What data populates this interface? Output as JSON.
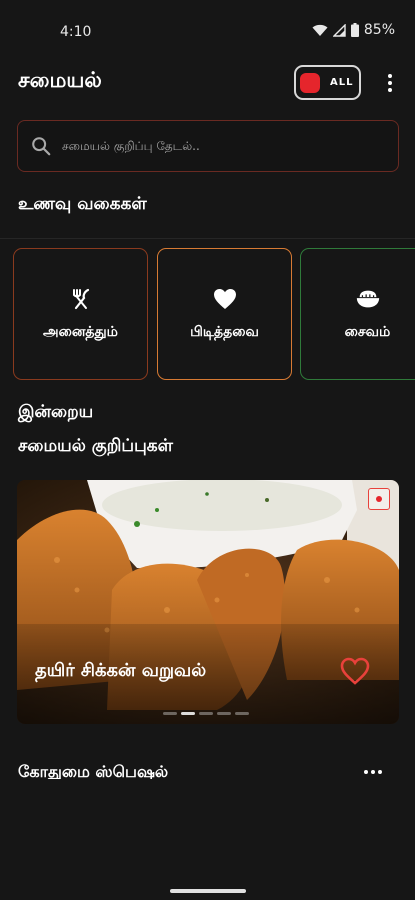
{
  "status_bar": {
    "time": "4:10",
    "battery": "85%"
  },
  "header": {
    "title": "சமையல்",
    "toggle_label": "ALL"
  },
  "search": {
    "placeholder": "சமையல் குறிப்பு தேடல்.."
  },
  "categories": {
    "title": "உணவு வகைகள்",
    "items": [
      {
        "label": "அனைத்தும்",
        "icon": "fork-knife-icon",
        "border_color": "#8a3a1e"
      },
      {
        "label": "பிடித்தவை",
        "icon": "heart-icon",
        "border_color": "#d77a33"
      },
      {
        "label": "சைவம்",
        "icon": "bowl-icon",
        "border_color": "#2f7a3a"
      }
    ]
  },
  "today": {
    "title_line1": "இன்றைய",
    "title_line2": "சமையல் குறிப்புகள்",
    "featured": {
      "title": "தயிர் சிக்கன் வறுவல்",
      "slides": 5,
      "active_slide": 2
    }
  },
  "next_section": {
    "title": "கோதுமை ஸ்பெஷல்"
  },
  "colors": {
    "accent": "#e5252c",
    "background": "#161616",
    "heart": "#e8413b"
  }
}
